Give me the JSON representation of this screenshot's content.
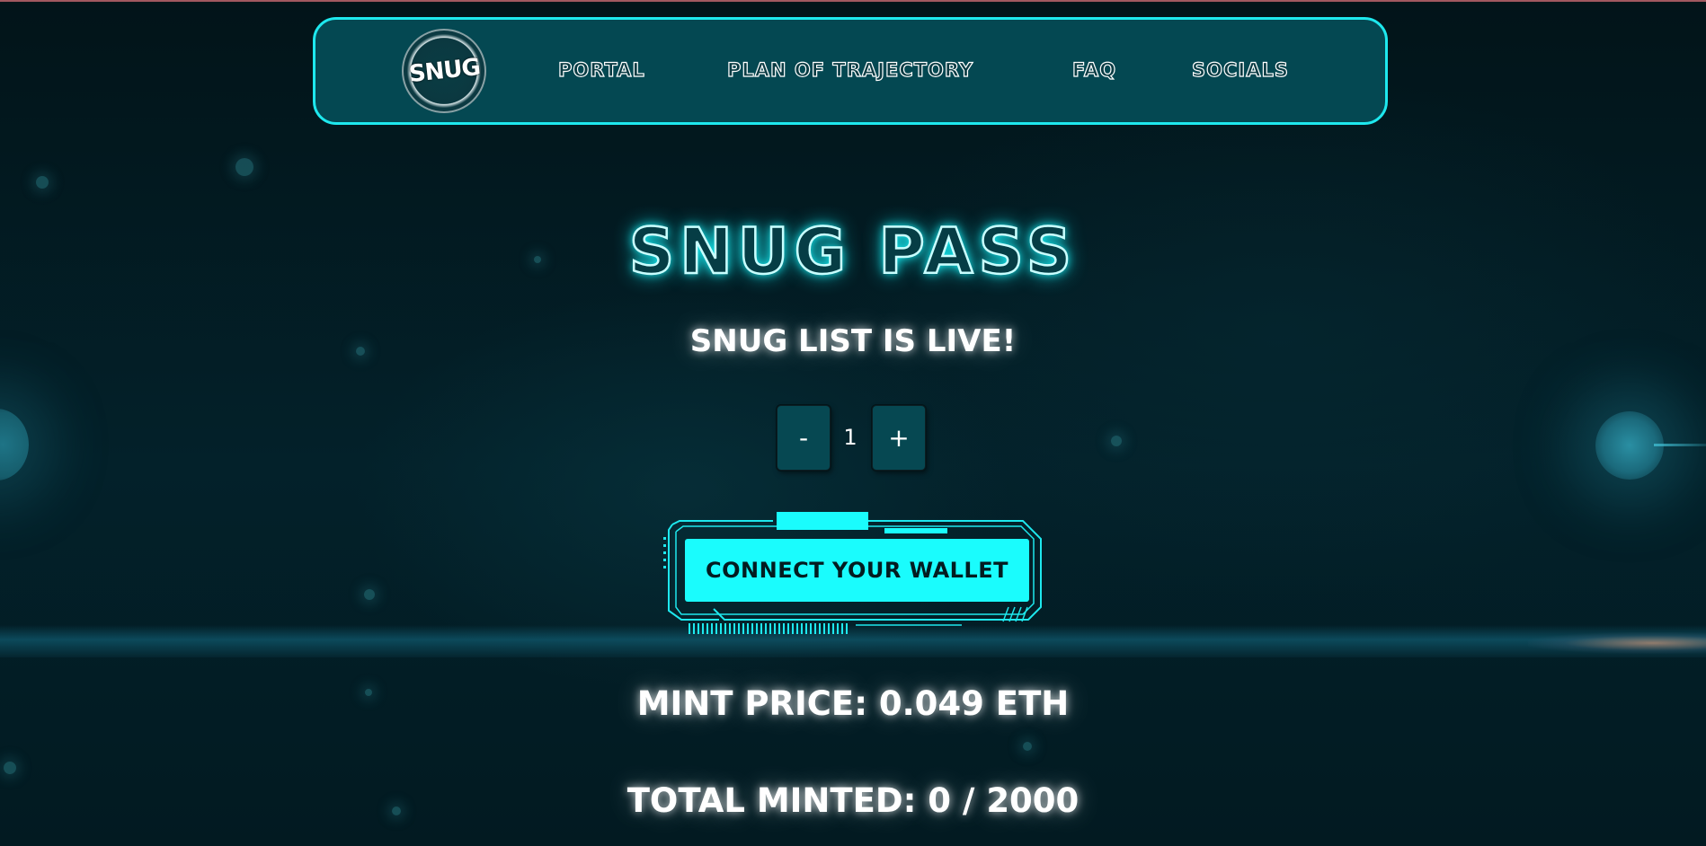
{
  "nav": {
    "logo_text": "SNUG",
    "links": [
      "PORTAL",
      "PLAN OF TRAJECTORY",
      "FAQ",
      "SOCIALS"
    ]
  },
  "main": {
    "title": "SNUG PASS",
    "subtitle": "SNUG LIST IS LIVE!",
    "quantity": {
      "decrement_label": "-",
      "value": "1",
      "increment_label": "+"
    },
    "connect_label": "CONNECT YOUR WALLET",
    "mint_price": "MINT PRICE: 0.049 ETH",
    "total_minted": "TOTAL MINTED: 0 / 2000"
  },
  "colors": {
    "accent": "#1afcfd",
    "navbar_bg": "#044852",
    "navbar_border": "#1ee8ee",
    "background": "#02171c"
  },
  "icons": {
    "logo": "snug-logo-icon",
    "frame": "hud-frame-decoration"
  }
}
